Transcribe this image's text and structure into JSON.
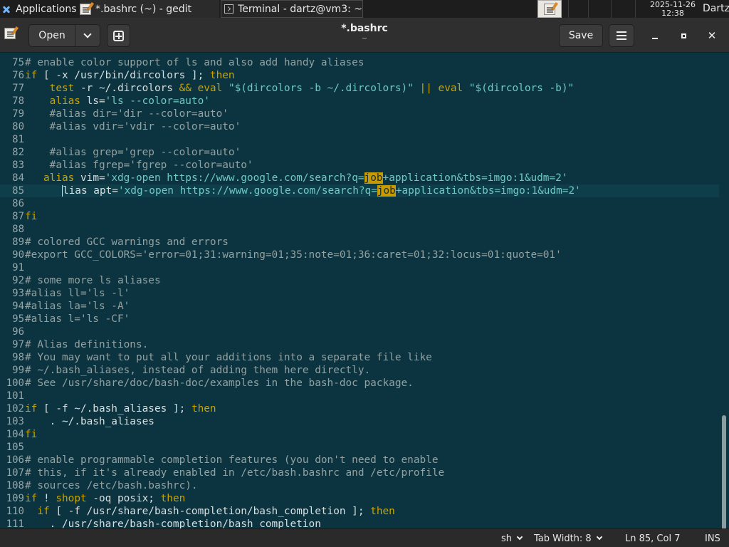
{
  "panel": {
    "apps_label": "Applications",
    "task_gedit": "*.bashrc (~) - gedit",
    "task_terminal": "Terminal - dartz@vm3: ~",
    "clock_date": "2025-11-26",
    "clock_time": "12:38",
    "user": "Dartz"
  },
  "header": {
    "open_label": "Open",
    "save_label": "Save",
    "title": "*.bashrc",
    "subtitle": "~"
  },
  "search_term": "job",
  "lines": [
    {
      "n": "75",
      "text": "# enable color support of ls and also add handy aliases"
    },
    {
      "n": "76",
      "text": "if [ -x /usr/bin/dircolors ]; then"
    },
    {
      "n": "77",
      "text": "    test -r ~/.dircolors && eval \"$(dircolors -b ~/.dircolors)\" || eval \"$(dircolors -b)\""
    },
    {
      "n": "78",
      "text": "    alias ls='ls --color=auto'"
    },
    {
      "n": "79",
      "text": "    #alias dir='dir --color=auto'"
    },
    {
      "n": "80",
      "text": "    #alias vdir='vdir --color=auto'"
    },
    {
      "n": "81",
      "text": ""
    },
    {
      "n": "82",
      "text": "    #alias grep='grep --color=auto'"
    },
    {
      "n": "83",
      "text": "    #alias fgrep='fgrep --color=auto'"
    },
    {
      "n": "84",
      "text": "   alias vim='xdg-open https://www.google.com/search?q=job+application&tbs=imgo:1&udm=2'"
    },
    {
      "n": "85",
      "text": "      lias apt='xdg-open https://www.google.com/search?q=job+application&tbs=imgo:1&udm=2'"
    },
    {
      "n": "86",
      "text": ""
    },
    {
      "n": "87",
      "text": "fi"
    },
    {
      "n": "88",
      "text": ""
    },
    {
      "n": "89",
      "text": "# colored GCC warnings and errors"
    },
    {
      "n": "90",
      "text": "#export GCC_COLORS='error=01;31:warning=01;35:note=01;36:caret=01;32:locus=01:quote=01'"
    },
    {
      "n": "91",
      "text": ""
    },
    {
      "n": "92",
      "text": "# some more ls aliases"
    },
    {
      "n": "93",
      "text": "#alias ll='ls -l'"
    },
    {
      "n": "94",
      "text": "#alias la='ls -A'"
    },
    {
      "n": "95",
      "text": "#alias l='ls -CF'"
    },
    {
      "n": "96",
      "text": ""
    },
    {
      "n": "97",
      "text": "# Alias definitions."
    },
    {
      "n": "98",
      "text": "# You may want to put all your additions into a separate file like"
    },
    {
      "n": "99",
      "text": "# ~/.bash_aliases, instead of adding them here directly."
    },
    {
      "n": "100",
      "text": "# See /usr/share/doc/bash-doc/examples in the bash-doc package."
    },
    {
      "n": "101",
      "text": ""
    },
    {
      "n": "102",
      "text": "if [ -f ~/.bash_aliases ]; then"
    },
    {
      "n": "103",
      "text": "    . ~/.bash_aliases"
    },
    {
      "n": "104",
      "text": "fi"
    },
    {
      "n": "105",
      "text": ""
    },
    {
      "n": "106",
      "text": "# enable programmable completion features (you don't need to enable"
    },
    {
      "n": "107",
      "text": "# this, if it's already enabled in /etc/bash.bashrc and /etc/profile"
    },
    {
      "n": "108",
      "text": "# sources /etc/bash.bashrc)."
    },
    {
      "n": "109",
      "text": "if ! shopt -oq posix; then"
    },
    {
      "n": "110",
      "text": "  if [ -f /usr/share/bash-completion/bash_completion ]; then"
    },
    {
      "n": "111",
      "text": "    . /usr/share/bash-completion/bash_completion"
    }
  ],
  "current_line": "85",
  "statusbar": {
    "language": "sh",
    "tab_width": "Tab Width: 8",
    "position": "Ln 85, Col 7",
    "mode": "INS"
  },
  "colors": {
    "editor_bg": "#0c3440",
    "keyword": "#c9a400",
    "string": "#6fc9c3",
    "comment": "#93a1a1",
    "search_highlight": "#c79a00"
  }
}
